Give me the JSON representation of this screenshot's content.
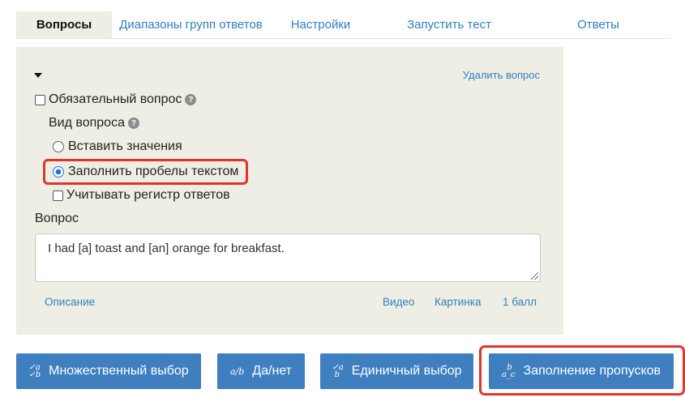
{
  "tabs": [
    {
      "label": "Вопросы"
    },
    {
      "label": "Диапазоны групп ответов"
    },
    {
      "label": "Настройки"
    },
    {
      "label": "Запустить тест"
    },
    {
      "label": "Ответы"
    }
  ],
  "panel": {
    "delete_link": "Удалить вопрос",
    "required_label": "Обязательный вопрос",
    "type_label": "Вид вопроса",
    "options": [
      {
        "label": "Вставить значения",
        "selected": false
      },
      {
        "label": "Заполнить пробелы текстом",
        "selected": true
      }
    ],
    "case_label": "Учитывать регистр ответов",
    "question_label": "Вопрос",
    "question_text": "I had [a] toast and [an] orange for breakfast.",
    "links": {
      "description": "Описание",
      "video": "Видео",
      "picture": "Картинка",
      "points": "1 балл"
    }
  },
  "buttons": [
    {
      "label": "Множественный выбор",
      "icon": "multiple-choice-icon"
    },
    {
      "label": "Да/нет",
      "icon": "yes-no-icon"
    },
    {
      "label": "Единичный выбор",
      "icon": "single-choice-icon"
    },
    {
      "label": "Заполнение пропусков",
      "icon": "fill-gaps-icon"
    }
  ],
  "colors": {
    "accent": "#3f7fc0",
    "link": "#2f80c3",
    "panel": "#eeeee4",
    "highlight": "#e0352b"
  }
}
